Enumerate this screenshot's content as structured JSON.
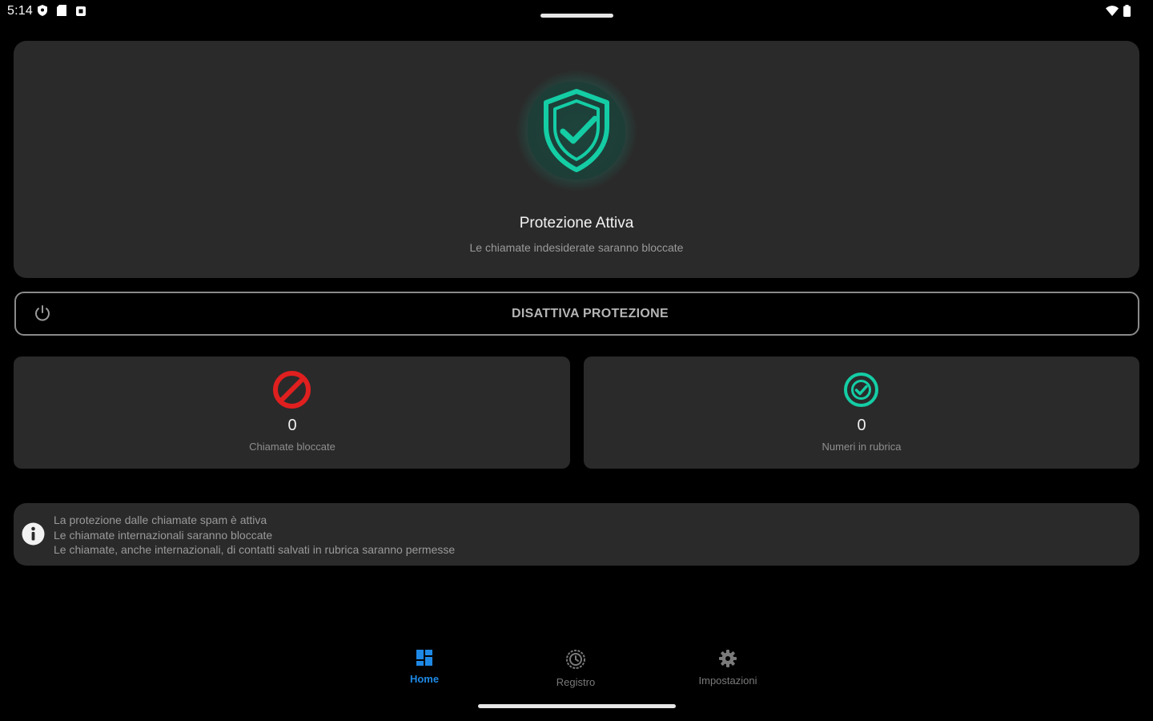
{
  "status_bar": {
    "time": "5:14",
    "left_icons": [
      "shield-status-icon",
      "sd-card-icon",
      "notification-square-icon"
    ],
    "right_icons": [
      "wifi-icon",
      "battery-icon"
    ]
  },
  "hero": {
    "icon": "shield-check-icon",
    "title": "Protezione Attiva",
    "subtitle": "Le chiamate indesiderate saranno bloccate",
    "accent_color": "#14cda5"
  },
  "disable_button": {
    "icon": "power-icon",
    "label": "DISATTIVA PROTEZIONE"
  },
  "stats": [
    {
      "icon": "block-icon",
      "value": "0",
      "label": "Chiamate bloccate",
      "color": "#e01f1f"
    },
    {
      "icon": "check-circle-icon",
      "value": "0",
      "label": "Numeri in rubrica",
      "color": "#14cda5"
    }
  ],
  "info": {
    "icon": "info-icon",
    "lines": [
      "La protezione dalle chiamate spam è attiva",
      "Le chiamate internazionali saranno bloccate",
      "Le chiamate, anche internazionali, di contatti salvati in rubrica saranno permesse"
    ]
  },
  "bottom_nav": {
    "items": [
      {
        "icon": "dashboard-icon",
        "label": "Home",
        "active": true
      },
      {
        "icon": "history-icon",
        "label": "Registro",
        "active": false
      },
      {
        "icon": "gear-icon",
        "label": "Impostazioni",
        "active": false
      }
    ],
    "active_color": "#1e88e5"
  }
}
